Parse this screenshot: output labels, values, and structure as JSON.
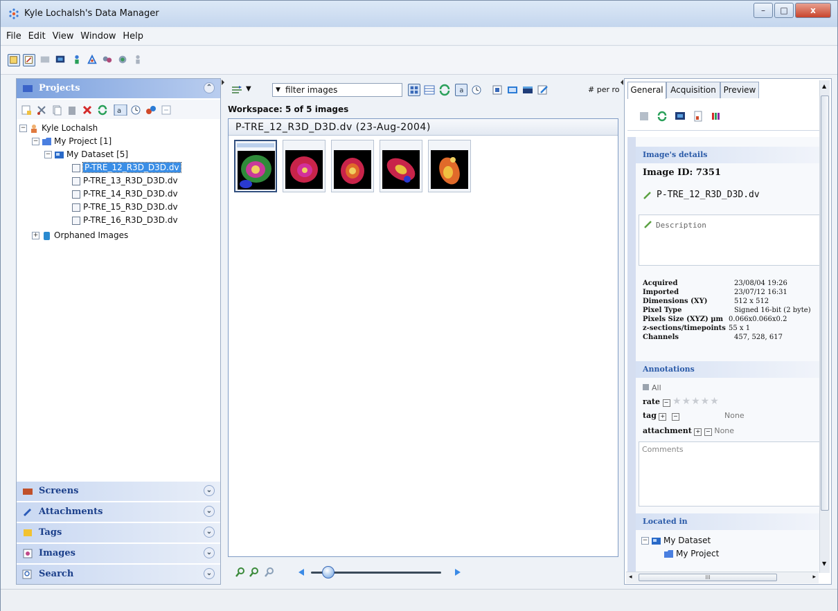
{
  "window": {
    "title": "Kyle Lochalsh's Data Manager",
    "minimize": "–",
    "maximize": "□",
    "close": "x"
  },
  "menu": [
    "File",
    "Edit",
    "View",
    "Window",
    "Help"
  ],
  "left": {
    "projects_label": "Projects",
    "tree": {
      "user": "Kyle Lochalsh",
      "project": "My Project [1]",
      "dataset": "My Dataset [5]",
      "images": [
        "P-TRE_12_R3D_D3D.dv",
        "P-TRE_13_R3D_D3D.dv",
        "P-TRE_14_R3D_D3D.dv",
        "P-TRE_15_R3D_D3D.dv",
        "P-TRE_16_R3D_D3D.dv"
      ],
      "orphaned": "Orphaned Images"
    },
    "sections": [
      "Screens",
      "Attachments",
      "Tags",
      "Images",
      "Search"
    ]
  },
  "center": {
    "filter_placeholder": "filter images",
    "per_row": "# per ro",
    "workspace": "Workspace: 5 of 5 images",
    "group_title": "P-TRE_12_R3D_D3D.dv (23-Aug-2004)"
  },
  "right": {
    "tabs": [
      "General",
      "Acquisition",
      "Preview"
    ],
    "details_header": "Image's details",
    "image_id": "Image ID: 7351",
    "image_name": "P-TRE_12_R3D_D3D.dv",
    "description_placeholder": "Description",
    "metadata": [
      {
        "k": "Acquired",
        "v": "23/08/04 19:26"
      },
      {
        "k": "Imported",
        "v": "23/07/12 16:31"
      },
      {
        "k": "Dimensions (XY)",
        "v": "512 x 512"
      },
      {
        "k": "Pixel Type",
        "v": "Signed 16-bit (2 byte)"
      },
      {
        "k": "Pixels Size (XYZ) µm",
        "v": "0.066x0.066x0.2"
      },
      {
        "k": "z-sections/timepoints",
        "v": "55 x 1"
      },
      {
        "k": "Channels",
        "v": "457, 528, 617"
      }
    ],
    "annotations_header": "Annotations",
    "all_label": "All",
    "rate_label": "rate",
    "tag_label": "tag",
    "tag_value": "None",
    "attachment_label": "attachment",
    "attachment_value": "None",
    "comments_placeholder": "Comments",
    "located_header": "Located in",
    "located_dataset": "My Dataset",
    "located_project": "My Project",
    "hscroll_label": "III"
  },
  "colors": {
    "accent": "#3a8ee6",
    "header": "#7aa0de"
  }
}
